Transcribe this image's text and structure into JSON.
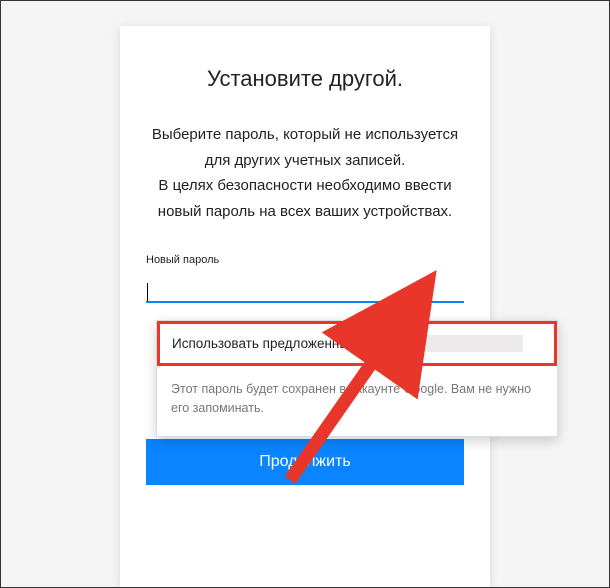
{
  "title": "Установите другой.",
  "description": "Выберите пароль, который не используется для других учетных записей.\nВ целях безопасности необходимо ввести новый пароль на всех ваших устройствах.",
  "field_label": "Новый пароль",
  "password_value": "",
  "suggest": {
    "action_label": "Использовать предложенный пароль",
    "note": "Этот пароль будет сохранен в аккаунте Google. Вам не нужно его запоминать."
  },
  "continue_label": "Продолжить"
}
